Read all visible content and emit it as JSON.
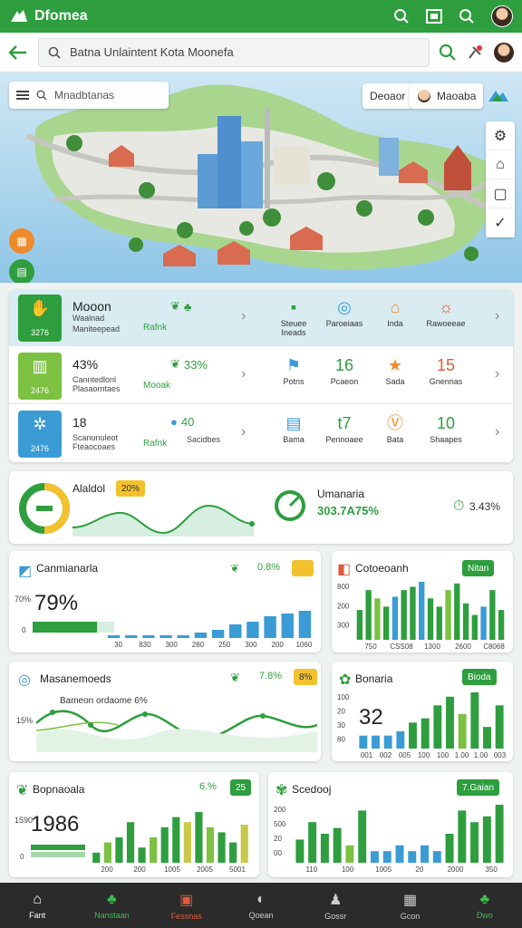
{
  "app": {
    "title": "Dfomea"
  },
  "search": {
    "value": "Batna Unlaintent Kota Moonefa"
  },
  "map": {
    "search_placeholder": "Mnadbtanas",
    "chip1": "Deoaor",
    "chip2": "Maoaba"
  },
  "categories": {
    "rows": [
      {
        "badge_value": "3276",
        "title": "Mooon",
        "title_sub": "Waalnad",
        "subtitle": "Maniteepead",
        "link": "Rafnk",
        "stat": "",
        "items": [
          {
            "label": "Steuee Ineads",
            "glyph": "▪"
          },
          {
            "label": "Paroeiaas",
            "glyph": "◎"
          },
          {
            "label": "Inda",
            "glyph": "⌂"
          },
          {
            "label": "Rawoeeae",
            "glyph": "☼"
          }
        ]
      },
      {
        "badge_value": "2476",
        "title": "43%",
        "subtitle": "Canntedlonl Plasaorntaes",
        "link": "Mooak",
        "stat": "33%",
        "items": [
          {
            "label": "Potns",
            "glyph": "⚑"
          },
          {
            "label": "Pcaeon",
            "glyph": "16"
          },
          {
            "label": "Sada",
            "glyph": "★"
          },
          {
            "label": "Gnennas",
            "glyph": "15"
          }
        ]
      },
      {
        "badge_value": "2476",
        "title": "18",
        "subtitle": "Scanunuleot Fteaocoaes",
        "link": "Rafnk",
        "stat": "40",
        "stat_label": "Sacidbes",
        "items": [
          {
            "label": "Bama",
            "glyph": "▤"
          },
          {
            "label": "Pennoaee",
            "glyph": "t7"
          },
          {
            "label": "Bata",
            "glyph": "Ⓥ"
          },
          {
            "label": "Shaapes",
            "glyph": "10"
          }
        ]
      }
    ]
  },
  "trend": {
    "title": "Alaldol",
    "badge": "20%",
    "right_title": "Umanaria",
    "right_value": "303.7A75%",
    "right_stat": "3.43%"
  },
  "cards": {
    "c1": {
      "title": "Canmianarla",
      "stat": "0.8%",
      "big": "79%",
      "axis_label": "70%",
      "ticks": [
        "30",
        "830",
        "300",
        "280",
        "250",
        "300",
        "200",
        "1060"
      ]
    },
    "c2": {
      "title": "Cotoeoanh",
      "pill": "Nitan",
      "ticks": [
        "750",
        "CSS08",
        "1300",
        "2600",
        "C8068"
      ],
      "yticks": [
        "800",
        "200",
        "300"
      ]
    },
    "c3": {
      "title": "Masanemoeds",
      "stat": "7.8%",
      "pill": "8%",
      "annotation": "Bameon ordaome 6%",
      "axis_label": "15%"
    },
    "c4": {
      "title": "Bonaria",
      "pill": "Bioda",
      "big": "32",
      "ticks": [
        "001",
        "002",
        "005",
        "100",
        "100",
        "1.00",
        "1.00",
        "003"
      ],
      "yticks": [
        "100",
        "20",
        "30",
        "80"
      ]
    },
    "c5": {
      "title": "Bopnaoala",
      "stat": "6.%",
      "pill": "25",
      "big": "1986",
      "axis_label": "1590",
      "ticks": [
        "200",
        "200",
        "1005",
        "2005",
        "5001"
      ]
    },
    "c6": {
      "title": "Scedooj",
      "pill": "7.Gaian",
      "ticks": [
        "110",
        "100",
        "1005",
        "20",
        "2000",
        "350"
      ],
      "yticks": [
        "200",
        "500",
        "20",
        "00"
      ]
    }
  },
  "chart_data": [
    {
      "type": "bar",
      "title": "Canmianarla",
      "values": [
        1,
        1,
        1,
        1,
        1,
        2,
        3,
        5,
        6,
        8,
        9,
        10
      ],
      "highlight": 0.79
    },
    {
      "type": "bar",
      "title": "Cotoeoanh",
      "values": [
        18,
        30,
        25,
        20,
        26,
        30,
        32,
        35,
        25,
        20,
        30,
        34,
        22,
        15,
        20,
        30,
        18
      ]
    },
    {
      "type": "line",
      "title": "Masanemoeds"
    },
    {
      "type": "bar",
      "title": "Bonaria",
      "values": [
        3,
        3,
        3,
        4,
        6,
        7,
        10,
        12,
        8,
        13,
        5,
        10
      ]
    },
    {
      "type": "bar",
      "title": "Bopnaoala",
      "values": [
        4,
        8,
        10,
        16,
        6,
        10,
        14,
        18,
        16,
        20,
        14,
        12,
        8,
        15
      ]
    },
    {
      "type": "bar",
      "title": "Scedooj",
      "values": [
        8,
        14,
        10,
        12,
        6,
        18,
        4,
        4,
        6,
        4,
        6,
        4,
        10,
        18,
        14,
        16,
        20
      ]
    }
  ],
  "nav": [
    {
      "label": "Fant",
      "glyph": "⌂"
    },
    {
      "label": "Nanstaan",
      "glyph": "♣"
    },
    {
      "label": "Fessnas",
      "glyph": "▣"
    },
    {
      "label": "Qoean",
      "glyph": "◐"
    },
    {
      "label": "Gossr",
      "glyph": "♟"
    },
    {
      "label": "Gcon",
      "glyph": "▦"
    },
    {
      "label": "Dwo",
      "glyph": "♣"
    }
  ],
  "colors": {
    "brand": "#2e9e3e",
    "accent_blue": "#3a9bd5",
    "yellow": "#f2c12e"
  }
}
